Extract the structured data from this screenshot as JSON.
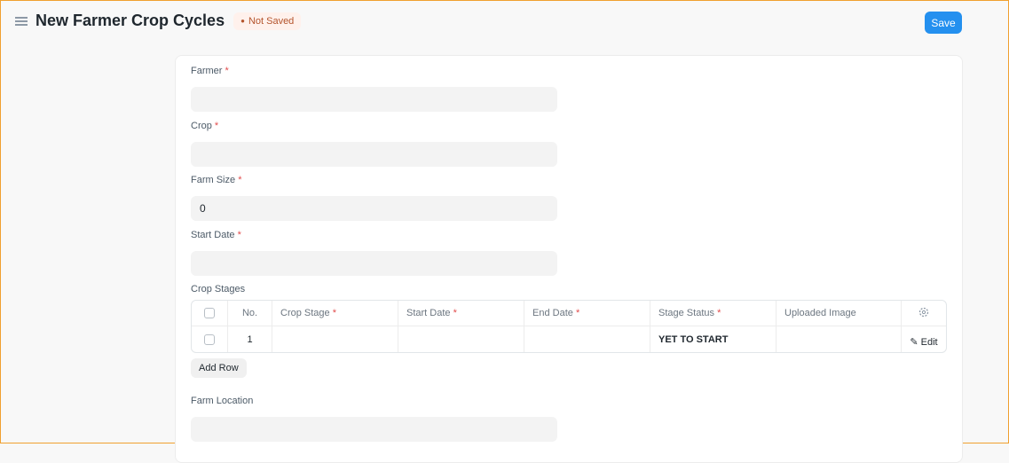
{
  "header": {
    "title": "New Farmer Crop Cycles",
    "status": "Not Saved",
    "save_label": "Save"
  },
  "fields": [
    {
      "label": "Farmer",
      "value": ""
    },
    {
      "label": "Crop",
      "value": ""
    },
    {
      "label": "Farm Size",
      "value": "0"
    },
    {
      "label": "Start Date",
      "value": ""
    }
  ],
  "crop_stages": {
    "label": "Crop Stages",
    "columns": [
      "No.",
      "Crop Stage",
      "Start Date",
      "End Date",
      "Stage Status",
      "Uploaded Image"
    ],
    "rows": [
      {
        "no": "1",
        "crop_stage": "",
        "start_date": "",
        "end_date": "",
        "stage_status": "YET TO START",
        "uploaded_image": ""
      }
    ],
    "edit_label": "Edit",
    "add_row_label": "Add Row"
  },
  "farm_location": {
    "label": "Farm Location",
    "value": ""
  },
  "required_mark": "*"
}
